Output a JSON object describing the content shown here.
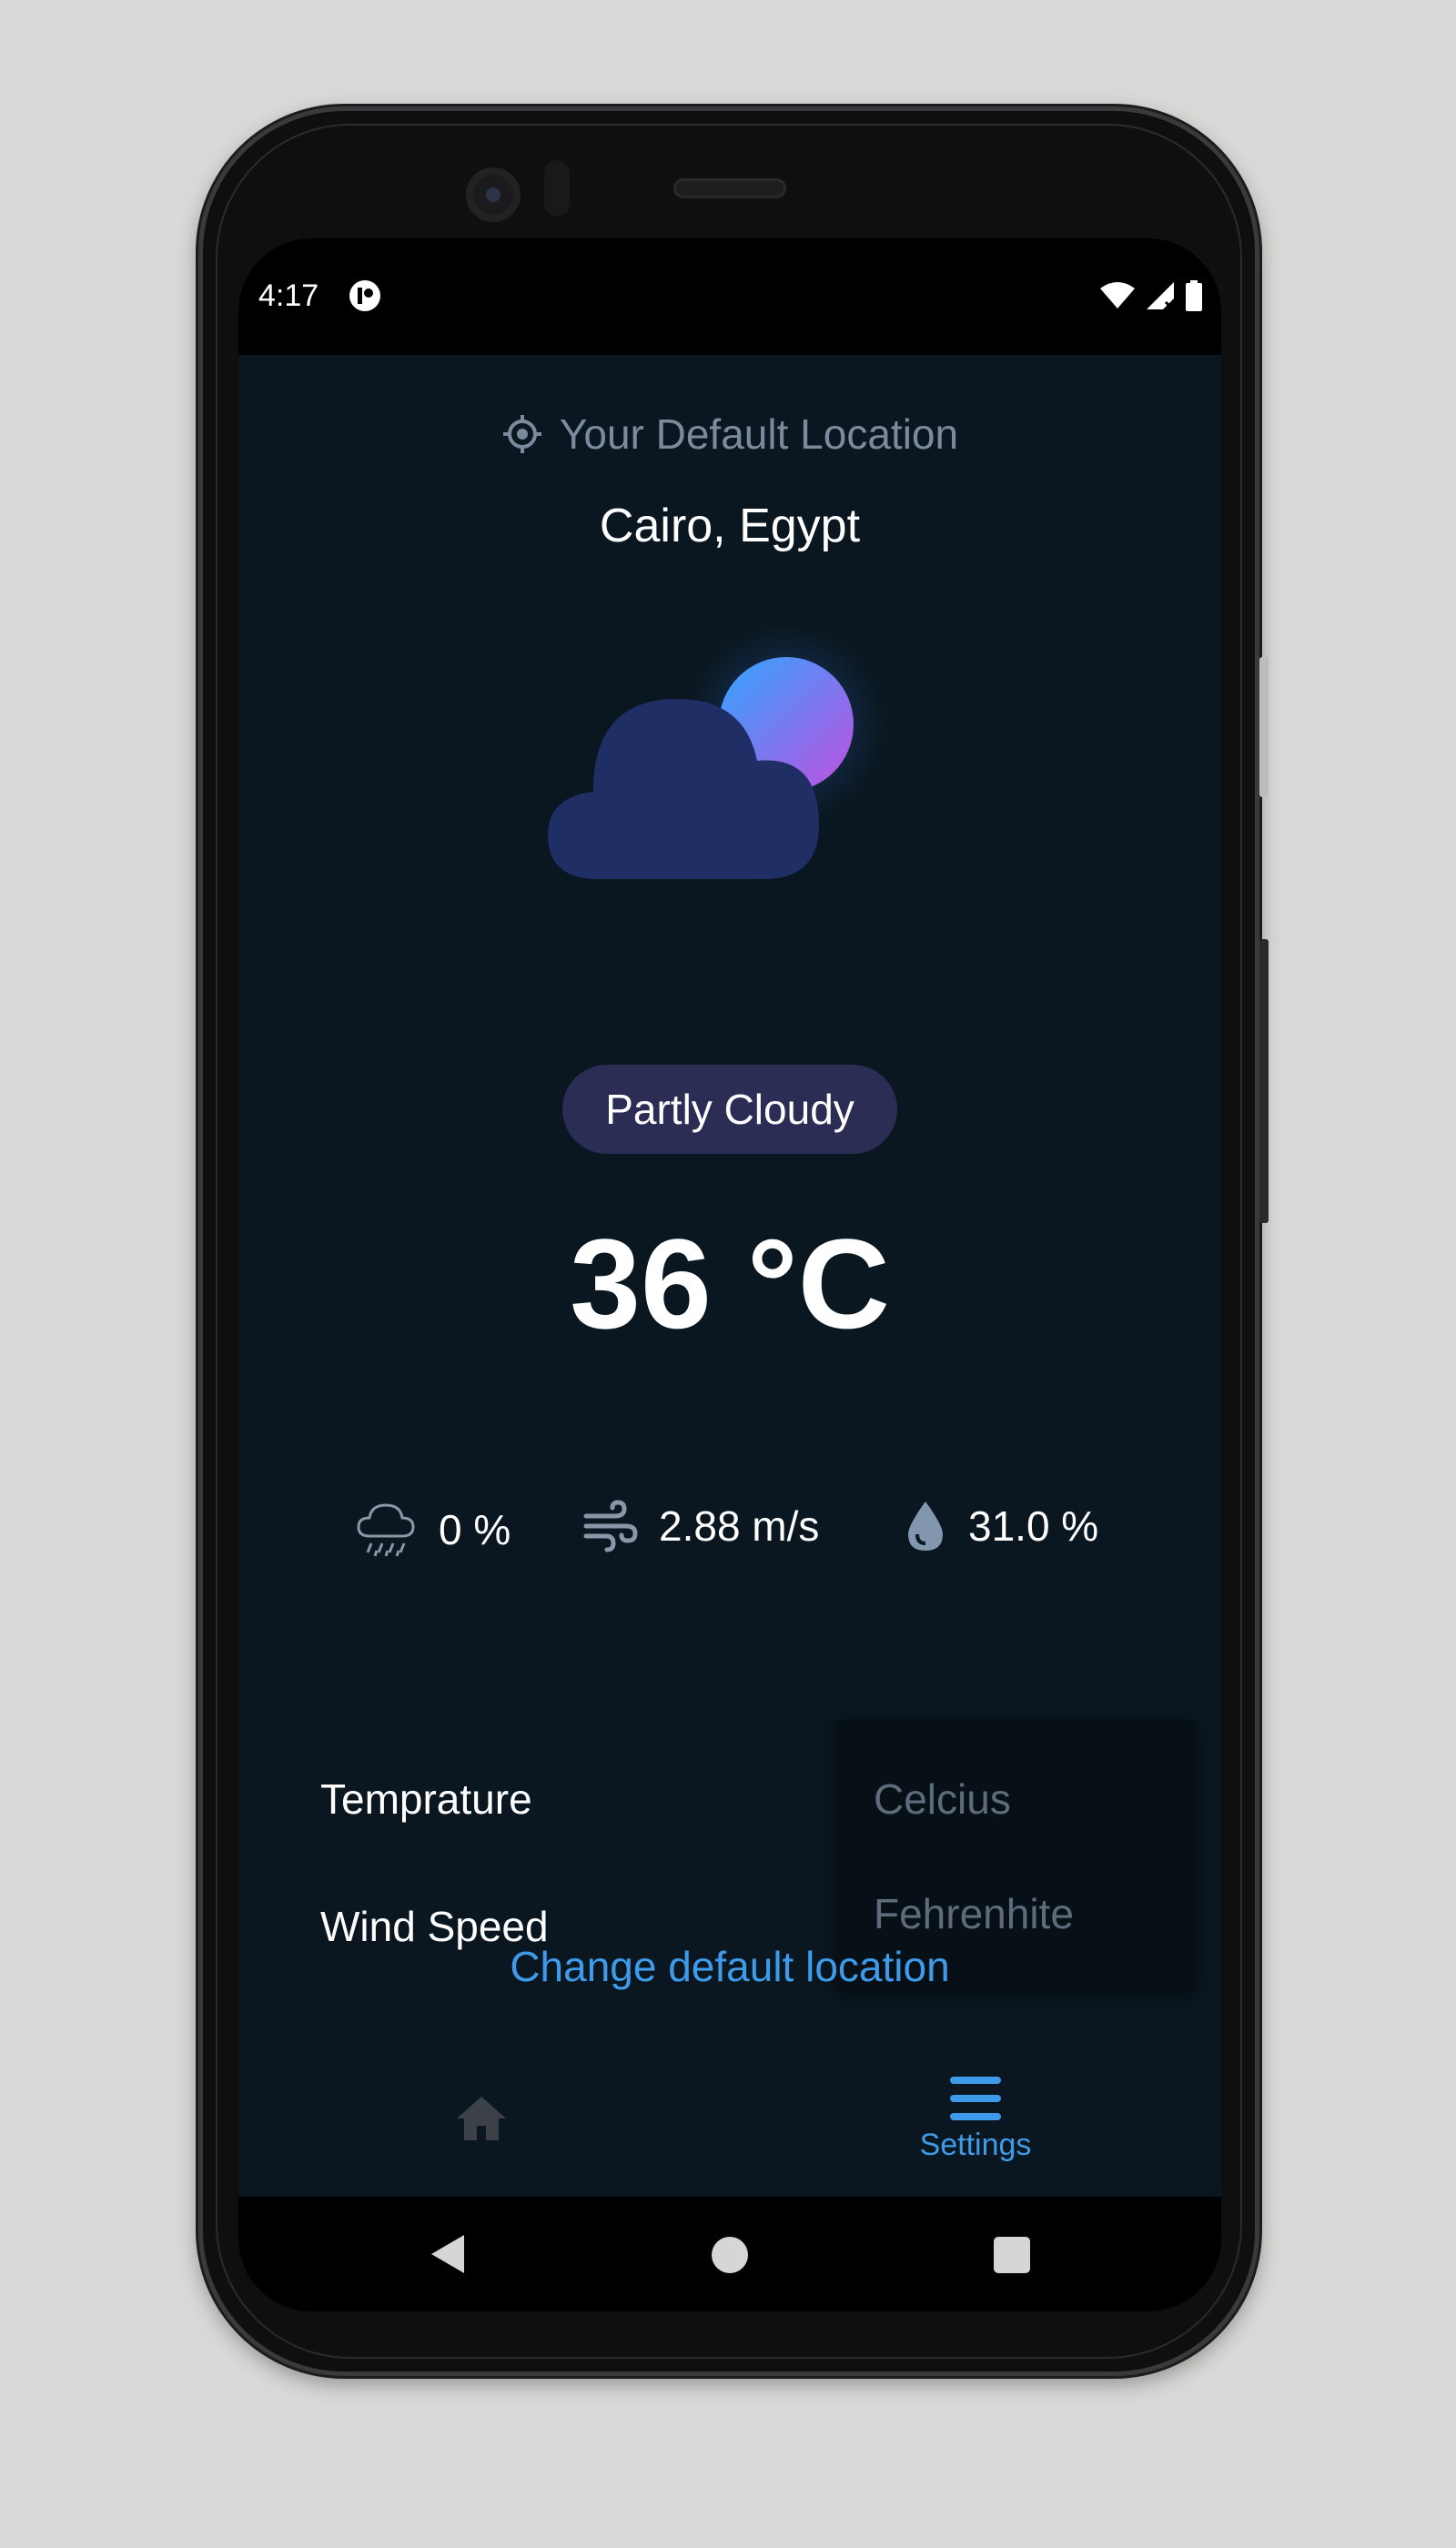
{
  "status_bar": {
    "time": "4:17",
    "icons": [
      "app-notification-icon",
      "wifi-icon",
      "signal-no-data-icon",
      "battery-icon"
    ]
  },
  "header": {
    "location_hint": "Your Default Location",
    "location_icon": "location-target-icon",
    "city": "Cairo, Egypt"
  },
  "weather": {
    "illustration_icon": "partly-cloudy-icon",
    "condition": "Partly Cloudy",
    "temperature": "36 °C",
    "stats": [
      {
        "icon": "rain-cloud-icon",
        "value": "0 %"
      },
      {
        "icon": "wind-icon",
        "value": "2.88 m/s"
      },
      {
        "icon": "humidity-drop-icon",
        "value": "31.0 %"
      }
    ]
  },
  "settings": {
    "labels": [
      "Temprature",
      "Wind Speed"
    ],
    "unit_dropdown": {
      "options": [
        "Celcius",
        "Fehrenhite"
      ]
    },
    "change_location": "Change default location"
  },
  "bottom_nav": {
    "home_icon": "home-icon",
    "settings_icon": "menu-icon",
    "settings_label": "Settings"
  },
  "colors": {
    "background": "#0a1720",
    "accent": "#3d9be9",
    "pill": "#2b2d55",
    "muted_text": "#7b8a9c"
  }
}
